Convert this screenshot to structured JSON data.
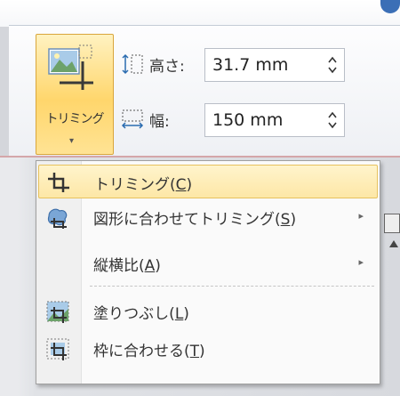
{
  "ribbon": {
    "crop_button": {
      "label": "トリミング",
      "dropdown_glyph": "▾",
      "icon": "crop-image-icon"
    },
    "height": {
      "label": "高さ:",
      "value": "31.7 mm",
      "icon": "shape-height-icon"
    },
    "width": {
      "label": "幅:",
      "value": "150 mm",
      "icon": "shape-width-icon"
    }
  },
  "menu": {
    "items": [
      {
        "text": "トリミング",
        "open": "(",
        "key": "C",
        "close": ")",
        "icon": "crop-icon",
        "highlighted": true,
        "submenu": false
      },
      {
        "text": "図形に合わせてトリミング",
        "open": "(",
        "key": "S",
        "close": ")",
        "icon": "crop-to-shape-icon",
        "highlighted": false,
        "submenu": true
      },
      {
        "text": "縦横比",
        "open": "(",
        "key": "A",
        "close": ")",
        "icon": "",
        "highlighted": false,
        "submenu": true
      },
      {
        "text": "塗りつぶし",
        "open": "(",
        "key": "L",
        "close": ")",
        "icon": "fill-icon",
        "highlighted": false,
        "submenu": false
      },
      {
        "text": "枠に合わせる",
        "open": "(",
        "key": "T",
        "close": ")",
        "icon": "fit-icon",
        "highlighted": false,
        "submenu": false
      }
    ],
    "submenu_arrow": "▸"
  },
  "colors": {
    "highlight": "#fde7a6",
    "button_active": "#ffd66c",
    "accent_blue": "#3b6fb6"
  }
}
